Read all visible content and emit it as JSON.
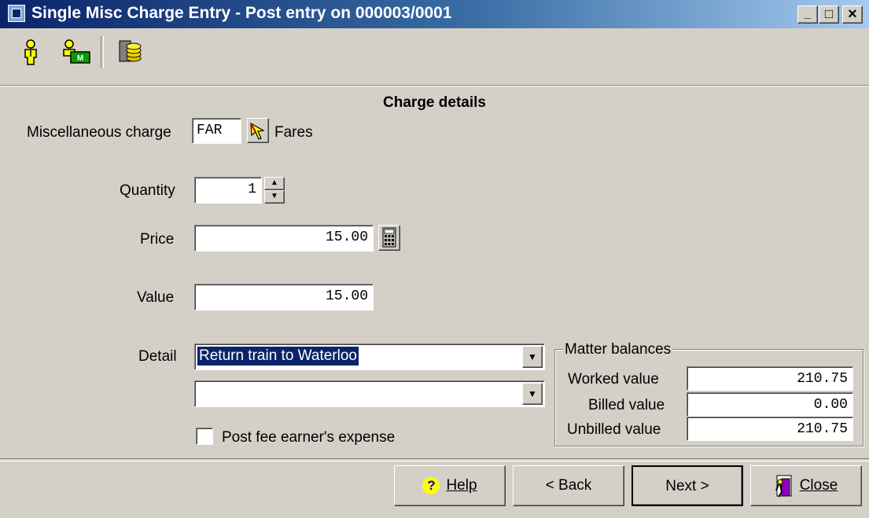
{
  "window": {
    "title": "Single Misc Charge Entry - Post entry on 000003/0001",
    "minimize": "_",
    "maximize": "□",
    "close": "×"
  },
  "section_title": "Charge details",
  "form": {
    "misc_charge": {
      "label": "Miscellaneous charge",
      "code": "FAR",
      "description": "Fares"
    },
    "quantity": {
      "label": "Quantity",
      "value": "1"
    },
    "price": {
      "label": "Price",
      "value": "15.00"
    },
    "value": {
      "label": "Value",
      "value": "15.00"
    },
    "detail": {
      "label": "Detail",
      "line1": "Return train to Waterloo",
      "line2": ""
    },
    "expense": {
      "label": "Post fee earner's expense",
      "checked": false
    }
  },
  "matter_balances": {
    "title": "Matter balances",
    "rows": [
      {
        "label": "Worked value",
        "value": "210.75"
      },
      {
        "label": "Billed value",
        "value": "0.00"
      },
      {
        "label": "Unbilled value",
        "value": "210.75"
      }
    ]
  },
  "buttons": {
    "help": "Help",
    "back": "< Back",
    "next": "Next >",
    "close": "Close"
  },
  "colors": {
    "titlebar_start": "#0a246a",
    "titlebar_end": "#a6caf0",
    "selection": "#0a246a",
    "face": "#d4d0c8"
  },
  "icons": {
    "toolbar": [
      "fee-earner-icon",
      "matter-icon",
      "coins-icon"
    ],
    "lookup": "pointer-arrow-icon",
    "calculator": "calculator-icon",
    "help": "question-icon",
    "close": "exit-door-icon"
  }
}
